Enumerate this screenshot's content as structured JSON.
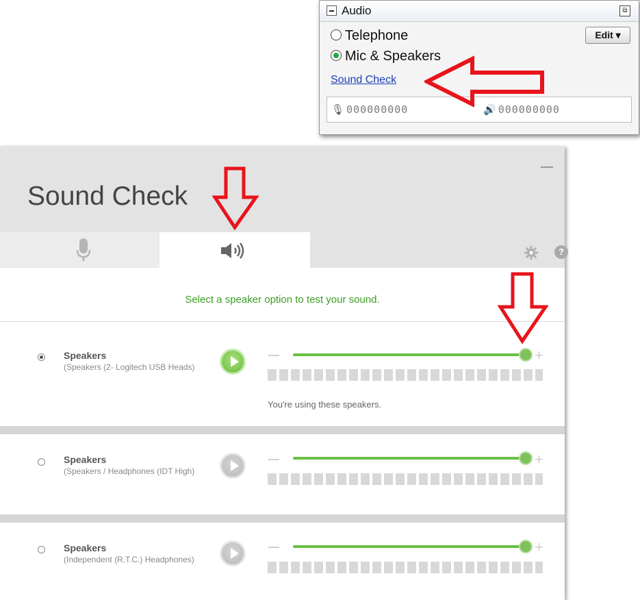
{
  "audio_panel": {
    "title": "Audio",
    "options": [
      {
        "label": "Telephone",
        "selected": false
      },
      {
        "label": "Mic & Speakers",
        "selected": true
      }
    ],
    "edit_label": "Edit ▾",
    "sound_check_link": "Sound Check",
    "mic_meter": "000000000",
    "speaker_meter": "000000000",
    "popout_icon": "⧉"
  },
  "sound_check": {
    "title": "Sound Check",
    "tabs": [
      {
        "name": "microphone",
        "icon": "microphone-icon",
        "active": false
      },
      {
        "name": "speaker",
        "icon": "speaker-icon",
        "active": true
      }
    ],
    "help_label": "?",
    "instruction": "Select a speaker option to test your sound.",
    "speakers": [
      {
        "name": "Speakers",
        "description": "(Speakers (2- Logitech USB Heads)",
        "selected": true,
        "volume": 1.0,
        "status": "You're using these speakers."
      },
      {
        "name": "Speakers",
        "description": "(Speakers / Headphones (IDT High)",
        "selected": false,
        "volume": 1.0,
        "status": ""
      },
      {
        "name": "Speakers",
        "description": "(Independent (R.T.C.) Headphones)",
        "selected": false,
        "volume": 1.0,
        "status": ""
      }
    ]
  },
  "colors": {
    "accent_green": "#6abf45",
    "instruction_green": "#3a9e24",
    "annotation_red": "#e8141b",
    "link_blue": "#1a3fb3"
  }
}
